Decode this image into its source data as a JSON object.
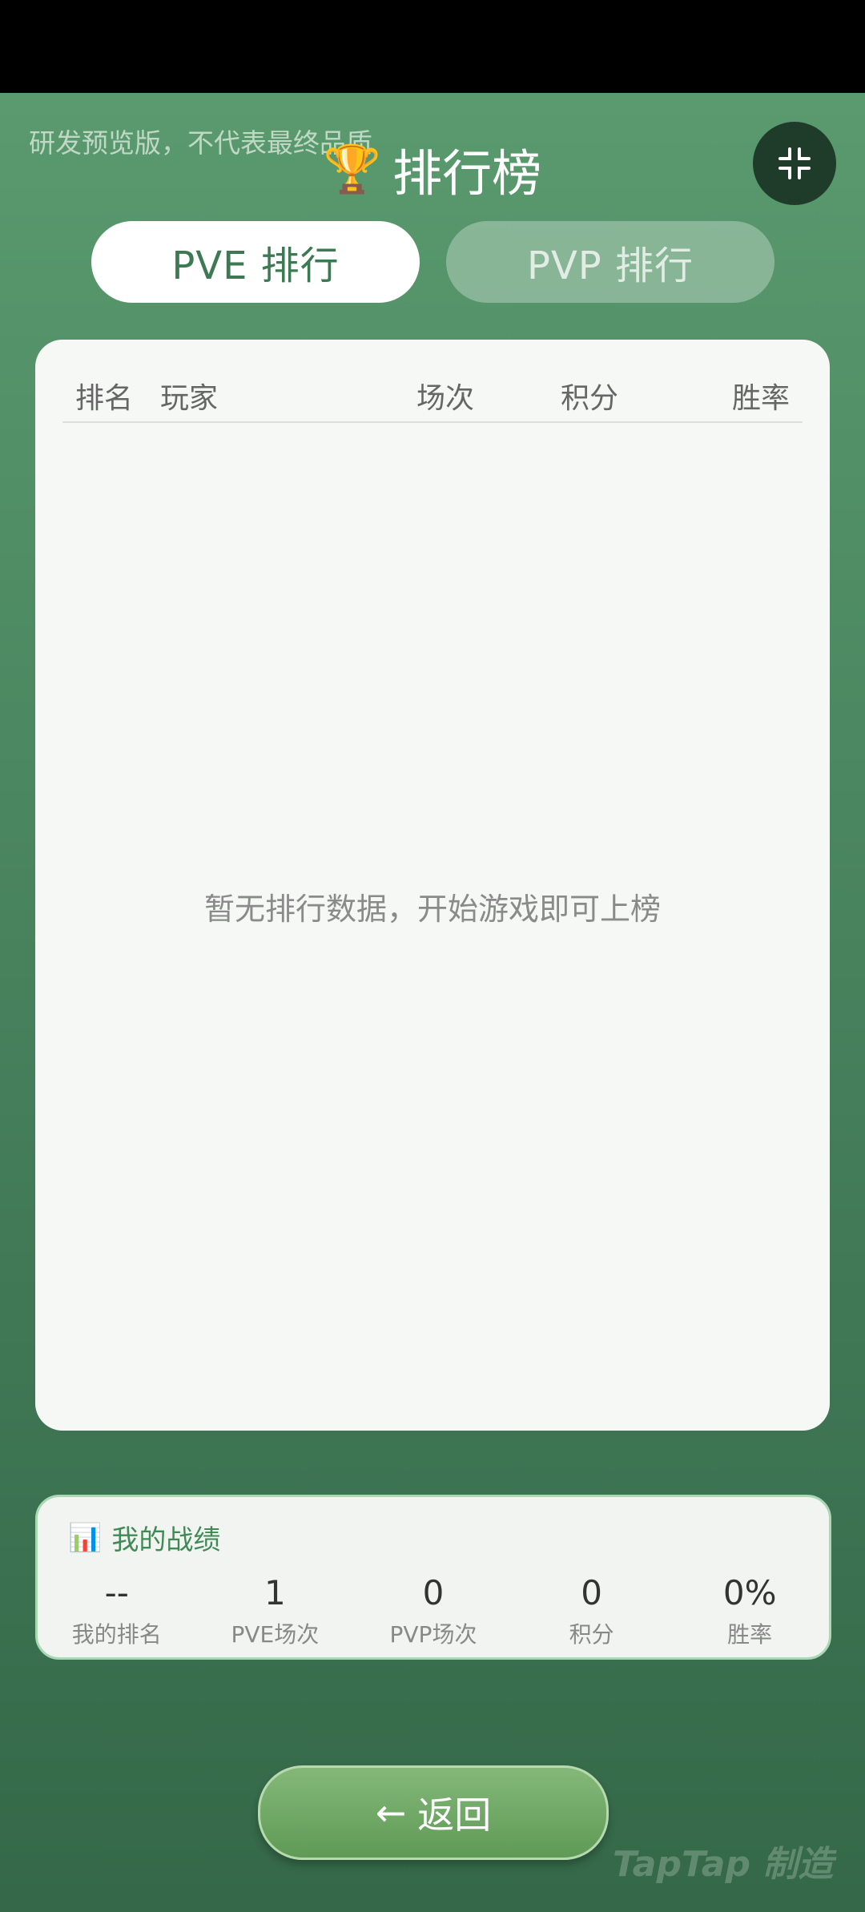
{
  "watermark": {
    "top_text": "研发预览版，不代表最终品质",
    "brand_text": "TapTap 制造"
  },
  "header": {
    "title": "排行榜",
    "trophy_icon": "🏆",
    "collapse_icon": "collapse-icon"
  },
  "tabs": [
    {
      "label": "PVE 排行",
      "active": true
    },
    {
      "label": "PVP 排行",
      "active": false
    }
  ],
  "leaderboard": {
    "columns": [
      "排名",
      "玩家",
      "场次",
      "积分",
      "胜率"
    ],
    "rows": [],
    "empty_message": "暂无排行数据，开始游戏即可上榜"
  },
  "my_stats": {
    "title": "我的战绩",
    "icon": "📊",
    "items": [
      {
        "value": "--",
        "label": "我的排名"
      },
      {
        "value": "1",
        "label": "PVE场次"
      },
      {
        "value": "0",
        "label": "PVP场次"
      },
      {
        "value": "0",
        "label": "积分"
      },
      {
        "value": "0%",
        "label": "胜率"
      }
    ]
  },
  "back_button": {
    "arrow": "←",
    "label": "返回"
  },
  "colors": {
    "accent": "#3d7a53",
    "card_border": "#a9d9b2",
    "background_top": "#5a9a6e",
    "background_bottom": "#346848"
  }
}
